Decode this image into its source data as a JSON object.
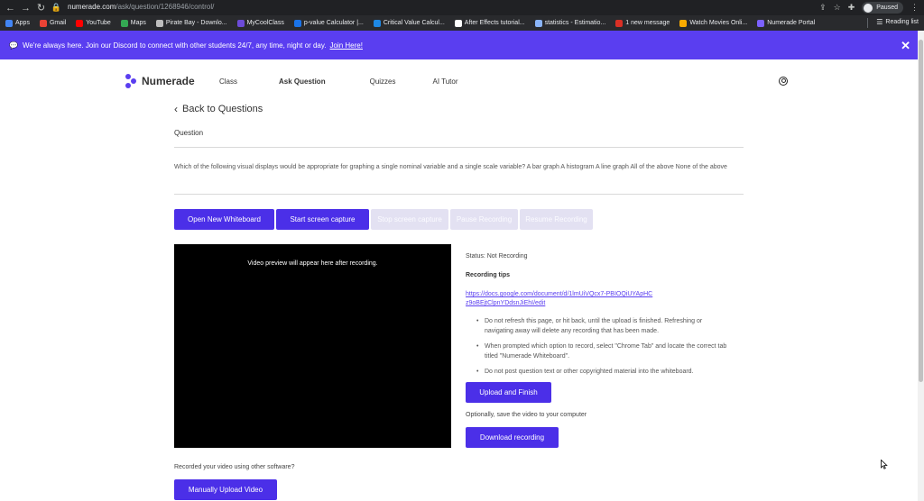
{
  "browser": {
    "url_host": "numerade.com",
    "url_path": "/ask/question/1268946/control/",
    "paused_label": "Paused",
    "bookmarks": [
      {
        "label": "Apps",
        "color": "#4285f4"
      },
      {
        "label": "Gmail",
        "color": "#ea4335"
      },
      {
        "label": "YouTube",
        "color": "#ff0000"
      },
      {
        "label": "Maps",
        "color": "#34a853"
      },
      {
        "label": "Pirate Bay - Downlo...",
        "color": "#bdbdbd"
      },
      {
        "label": "MyCoolClass",
        "color": "#6c4bd8"
      },
      {
        "label": "p-value Calculator |...",
        "color": "#1a73e8"
      },
      {
        "label": "Critical Value Calcul...",
        "color": "#1e88e5"
      },
      {
        "label": "After Effects tutorial...",
        "color": "#ffffff"
      },
      {
        "label": "statistics - Estimatio...",
        "color": "#8ab4f8"
      },
      {
        "label": "1 new message",
        "color": "#d93025"
      },
      {
        "label": "Watch Movies Onli...",
        "color": "#f9ab00"
      },
      {
        "label": "Numerade Portal",
        "color": "#7b61ff"
      }
    ],
    "reading_list": "Reading list"
  },
  "announcement": {
    "text": "We're always here. Join our Discord to connect with other students 24/7, any time, night or day.",
    "link": "Join Here!"
  },
  "header": {
    "logo": "Numerade",
    "nav": [
      "Class",
      "Ask Question",
      "Quizzes",
      "AI Tutor"
    ],
    "active_nav": "Ask Question"
  },
  "page": {
    "back_label": "Back to Questions",
    "question_label": "Question",
    "question_text": "Which of the following visual displays would be appropriate for graphing a single nominal variable and a single scale variable? A bar graph A histogram A line graph All of the above None of the above"
  },
  "toolbar": {
    "open_whiteboard": "Open New Whiteboard",
    "start_capture": "Start screen capture",
    "stop_capture": "Stop screen capture",
    "pause": "Pause Recording",
    "resume": "Resume Recording"
  },
  "video": {
    "placeholder": "Video preview will appear here after recording."
  },
  "recording": {
    "status": "Status: Not Recording",
    "tips_heading": "Recording tips",
    "tips_link": "https://docs.google.com/document/d/1lmUiVQcx7-PBIOQiUYApHCz9oBEjtClpnYDdsnJiEhI/edit",
    "tips": [
      "Do not refresh this page, or hit back, until the upload is finished. Refreshing or navigating away will delete any recording that has been made.",
      "When prompted which option to record, select \"Chrome Tab\" and locate the correct tab titled \"Numerade Whiteboard\".",
      "Do not post question text or other copyrighted material into the whiteboard."
    ],
    "upload_finish": "Upload and Finish",
    "optional_text": "Optionally, save the video to your computer",
    "download": "Download recording",
    "other_software": "Recorded your video using other software?",
    "manual_upload": "Manually Upload Video"
  },
  "colors": {
    "brand": "#5a3ef0",
    "button": "#4b2fe8",
    "disabled": "#e3e1f2"
  }
}
